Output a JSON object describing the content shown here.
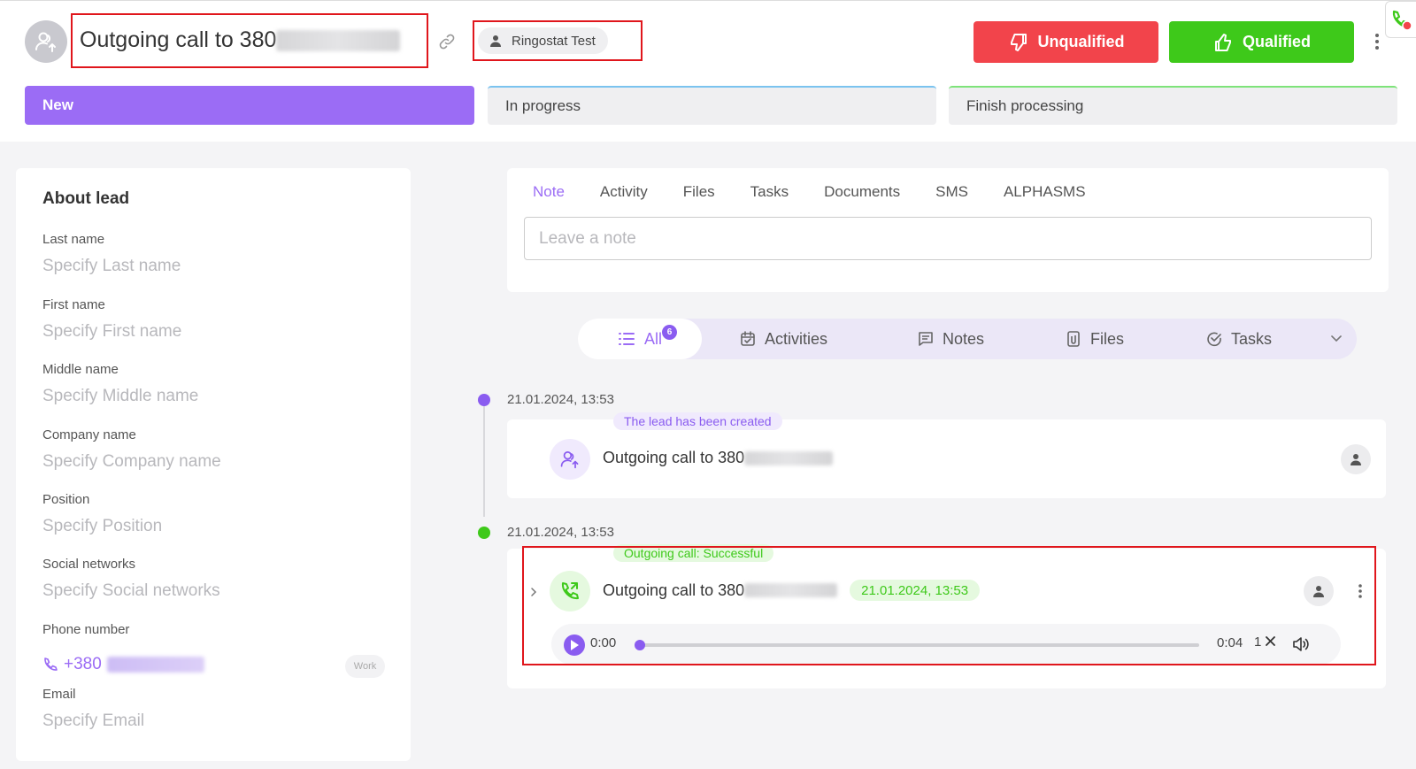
{
  "header": {
    "title_prefix": "Outgoing call to 380",
    "owner_name": "Ringostat Test",
    "unqualified_label": "Unqualified",
    "qualified_label": "Qualified"
  },
  "stages": [
    "New",
    "In progress",
    "Finish processing"
  ],
  "about": {
    "title": "About lead",
    "fields": [
      {
        "label": "Last name",
        "value": "Specify Last name"
      },
      {
        "label": "First name",
        "value": "Specify First name"
      },
      {
        "label": "Middle name",
        "value": "Specify Middle name"
      },
      {
        "label": "Company name",
        "value": "Specify Company name"
      },
      {
        "label": "Position",
        "value": "Specify Position"
      },
      {
        "label": "Social networks",
        "value": "Specify Social networks"
      },
      {
        "label": "Phone number",
        "value": "+380"
      },
      {
        "label": "Email",
        "value": "Specify Email"
      }
    ],
    "phone_type": "Work"
  },
  "note": {
    "tabs": [
      "Note",
      "Activity",
      "Files",
      "Tasks",
      "Documents",
      "SMS",
      "ALPHASMS"
    ],
    "placeholder": "Leave a note"
  },
  "filters": {
    "all_label": "All",
    "all_count": "6",
    "items": [
      "Activities",
      "Notes",
      "Files",
      "Tasks"
    ]
  },
  "timeline": [
    {
      "time": "21.01.2024, 13:53",
      "tag": "The lead has been created",
      "title": "Outgoing call to 380"
    },
    {
      "time": "21.01.2024, 13:53",
      "tag": "Outgoing call: Successful",
      "title": "Outgoing call to 380",
      "date_badge": "21.01.2024, 13:53",
      "player": {
        "current": "0:00",
        "duration": "0:04",
        "speed": "1",
        "progress": 0
      }
    }
  ],
  "colors": {
    "accent": "#9b6cf5",
    "danger": "#f2444b",
    "success": "#3ec91a",
    "highlight_border": "#e0161c"
  },
  "icons": [
    "user-arrow-icon",
    "link-icon",
    "person-icon",
    "thumb-down-icon",
    "thumb-up-icon",
    "kebab-icon",
    "phone-widget-icon",
    "list-icon",
    "calendar-icon",
    "note-icon",
    "file-icon",
    "check-circle-icon",
    "chevron-down-icon",
    "phone-call-icon",
    "chevron-right-icon",
    "play-icon",
    "close-icon",
    "volume-icon"
  ]
}
